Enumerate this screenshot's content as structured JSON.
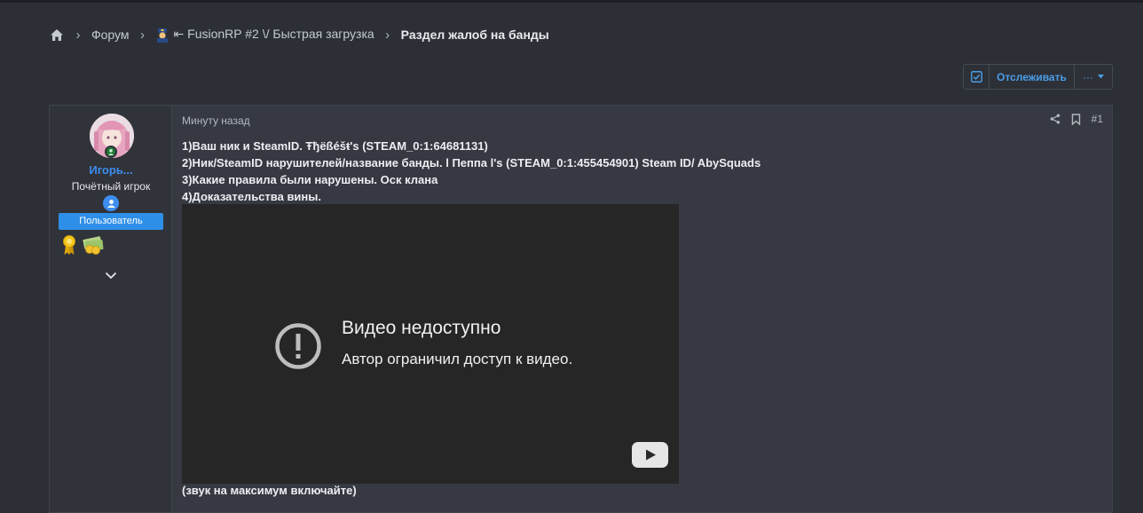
{
  "breadcrumb": {
    "home_icon": "home-icon",
    "items": [
      "Форум",
      "⇤ FusionRP #2 \\/ Быстрая загрузка"
    ],
    "current": "Раздел жалоб на банды"
  },
  "watch": {
    "label": "Отслеживать",
    "more_label": "···"
  },
  "post": {
    "time": "Минуту назад",
    "number": "#1",
    "user": {
      "name": "Игорь...",
      "title": "Почётный игрок",
      "banner": "Пользователь"
    },
    "lines": [
      "1)Ваш ник и SteamID. Ŧђëßéšŧ's (STEAM_0:1:64681131)",
      "2)Ник/SteamID нарушителей/название банды. l Пеппа l's (STEAM_0:1:455454901) Steam ID/ AbySquads",
      "3)Какие правила были нарушены. Оск клана",
      "4)Доказательства вины."
    ],
    "video": {
      "title": "Видео недоступно",
      "subtitle": "Автор ограничил доступ к видео."
    },
    "footer": "(звук на максимум включайте)"
  },
  "colors": {
    "background": "#2c2f36",
    "accent": "#3d8ef0",
    "banner": "#2e8fe8",
    "video_bg": "#262626"
  }
}
